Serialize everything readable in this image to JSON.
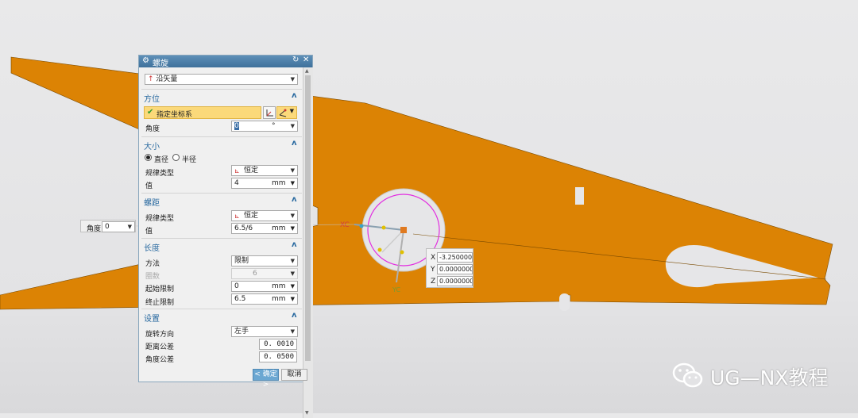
{
  "dialog": {
    "title": "螺旋",
    "type_select": "沿矢量",
    "orientation": {
      "header": "方位",
      "specify_csys": "指定坐标系",
      "angle_label": "角度",
      "angle_value": "0",
      "angle_unit": "°"
    },
    "size": {
      "header": "大小",
      "radio_diameter": "直径",
      "radio_radius": "半径",
      "selected": "直径",
      "law_type_label": "规律类型",
      "law_type_value": "恒定",
      "value_label": "值",
      "value": "4",
      "unit": "mm"
    },
    "pitch": {
      "header": "螺距",
      "law_type_label": "规律类型",
      "law_type_value": "恒定",
      "value_label": "值",
      "value": "6.5/6",
      "unit": "mm"
    },
    "length": {
      "header": "长度",
      "method_label": "方法",
      "method_value": "限制",
      "turns_label": "圈数",
      "turns_value": "6",
      "start_label": "起始限制",
      "start_value": "0",
      "start_unit": "mm",
      "end_label": "终止限制",
      "end_value": "6.5",
      "end_unit": "mm"
    },
    "settings": {
      "header": "设置",
      "direction_label": "旋转方向",
      "direction_value": "左手",
      "dist_tol_label": "距离公差",
      "dist_tol_value": "0. 0010",
      "angle_tol_label": "角度公差",
      "angle_tol_value": "0. 0500"
    },
    "ok_label": "< 确定 >",
    "cancel_label": "取消"
  },
  "floating_angle": {
    "label": "角度",
    "value": "0"
  },
  "coords": {
    "x": "-3.250000",
    "y": "0.0000000",
    "z": "0.0000000"
  },
  "axis_labels": {
    "xc": "XC",
    "yc": "YC"
  },
  "watermark": "UG—NX教程",
  "colors": {
    "part_fill": "#dc8304",
    "titlebar": "#4a7ba6",
    "section_header": "#2a6aa0",
    "highlight_row": "#fbd97a",
    "helix_circle": "#e22ee0"
  },
  "icons": {
    "gear": "gear-icon",
    "close": "close-icon",
    "reset": "reset-icon",
    "collapse": "chevron-up-icon",
    "check": "check-icon",
    "wechat": "wechat-icon"
  }
}
